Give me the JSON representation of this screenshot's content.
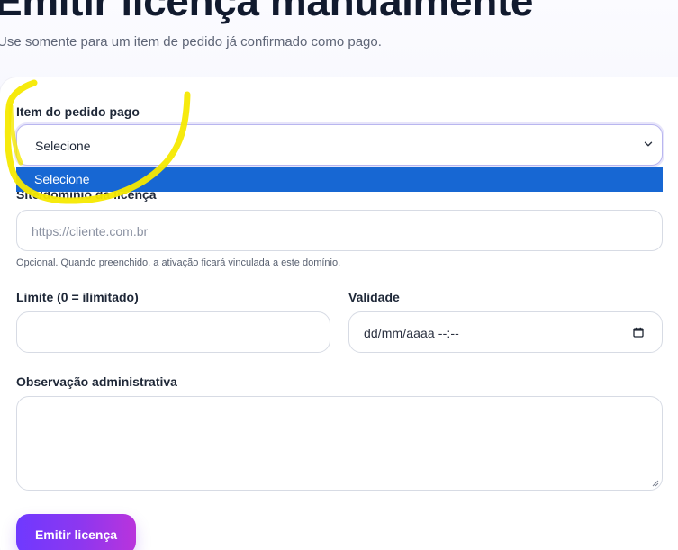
{
  "header": {
    "title": "Emitir licença manualmente",
    "subtitle": "Use somente para um item de pedido já confirmado como pago."
  },
  "form": {
    "order_item": {
      "label": "Item do pedido pago",
      "selected": "Selecione",
      "dropdown_open": true,
      "options": [
        "Selecione"
      ]
    },
    "site_domain": {
      "label": "Site/domínio da licença",
      "placeholder": "https://cliente.com.br",
      "value": "",
      "help": "Opcional. Quando preenchido, a ativação ficará vinculada a este domínio."
    },
    "limit": {
      "label": "Limite (0 = ilimitado)",
      "value": ""
    },
    "validity": {
      "label": "Validade",
      "display": "dd/mm/aaaa --:--"
    },
    "admin_note": {
      "label": "Observação administrativa",
      "value": ""
    },
    "submit_label": "Emitir licença"
  },
  "colors": {
    "button_gradient_start": "#6f39ff",
    "button_gradient_end": "#b934dc",
    "dropdown_highlight": "#1767d3",
    "annotation_stroke": "#f5e900"
  },
  "icons": {
    "select": "chevron-down-icon",
    "date": "calendar-icon",
    "textarea": "resize-handle-icon"
  }
}
